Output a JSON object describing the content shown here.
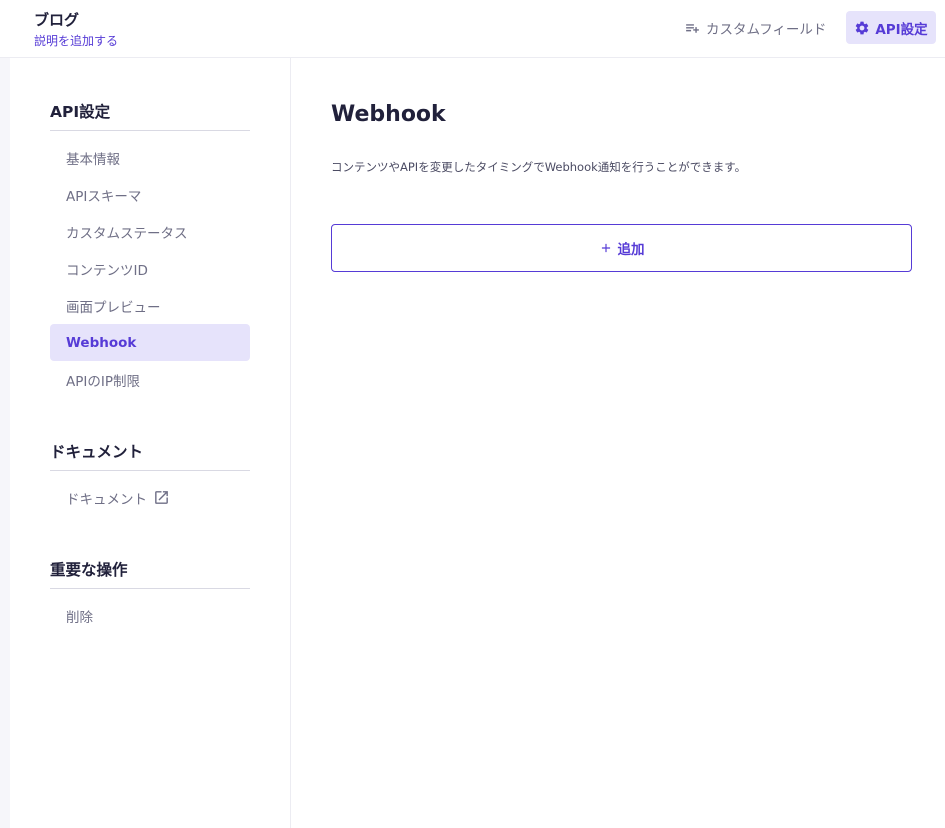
{
  "header": {
    "title": "ブログ",
    "subtitle": "説明を追加する",
    "custom_fields_label": "カスタムフィールド",
    "api_settings_label": "API設定"
  },
  "sidebar": {
    "sections": [
      {
        "title": "API設定",
        "items": [
          {
            "label": "基本情報"
          },
          {
            "label": "APIスキーマ"
          },
          {
            "label": "カスタムステータス"
          },
          {
            "label": "コンテンツID"
          },
          {
            "label": "画面プレビュー"
          },
          {
            "label": "Webhook",
            "active": true
          },
          {
            "label": "APIのIP制限"
          }
        ]
      },
      {
        "title": "ドキュメント",
        "items": [
          {
            "label": "ドキュメント",
            "icon": "external-link-icon"
          }
        ]
      },
      {
        "title": "重要な操作",
        "items": [
          {
            "label": "削除"
          }
        ]
      }
    ]
  },
  "main": {
    "title": "Webhook",
    "description": "コンテンツやAPIを変更したタイミングでWebhook通知を行うことができます。",
    "add_button_label": "追加"
  },
  "colors": {
    "accent": "#563bd6",
    "accent_bg": "#e6e3fb",
    "text": "#21213b",
    "muted": "#6f6f86"
  }
}
